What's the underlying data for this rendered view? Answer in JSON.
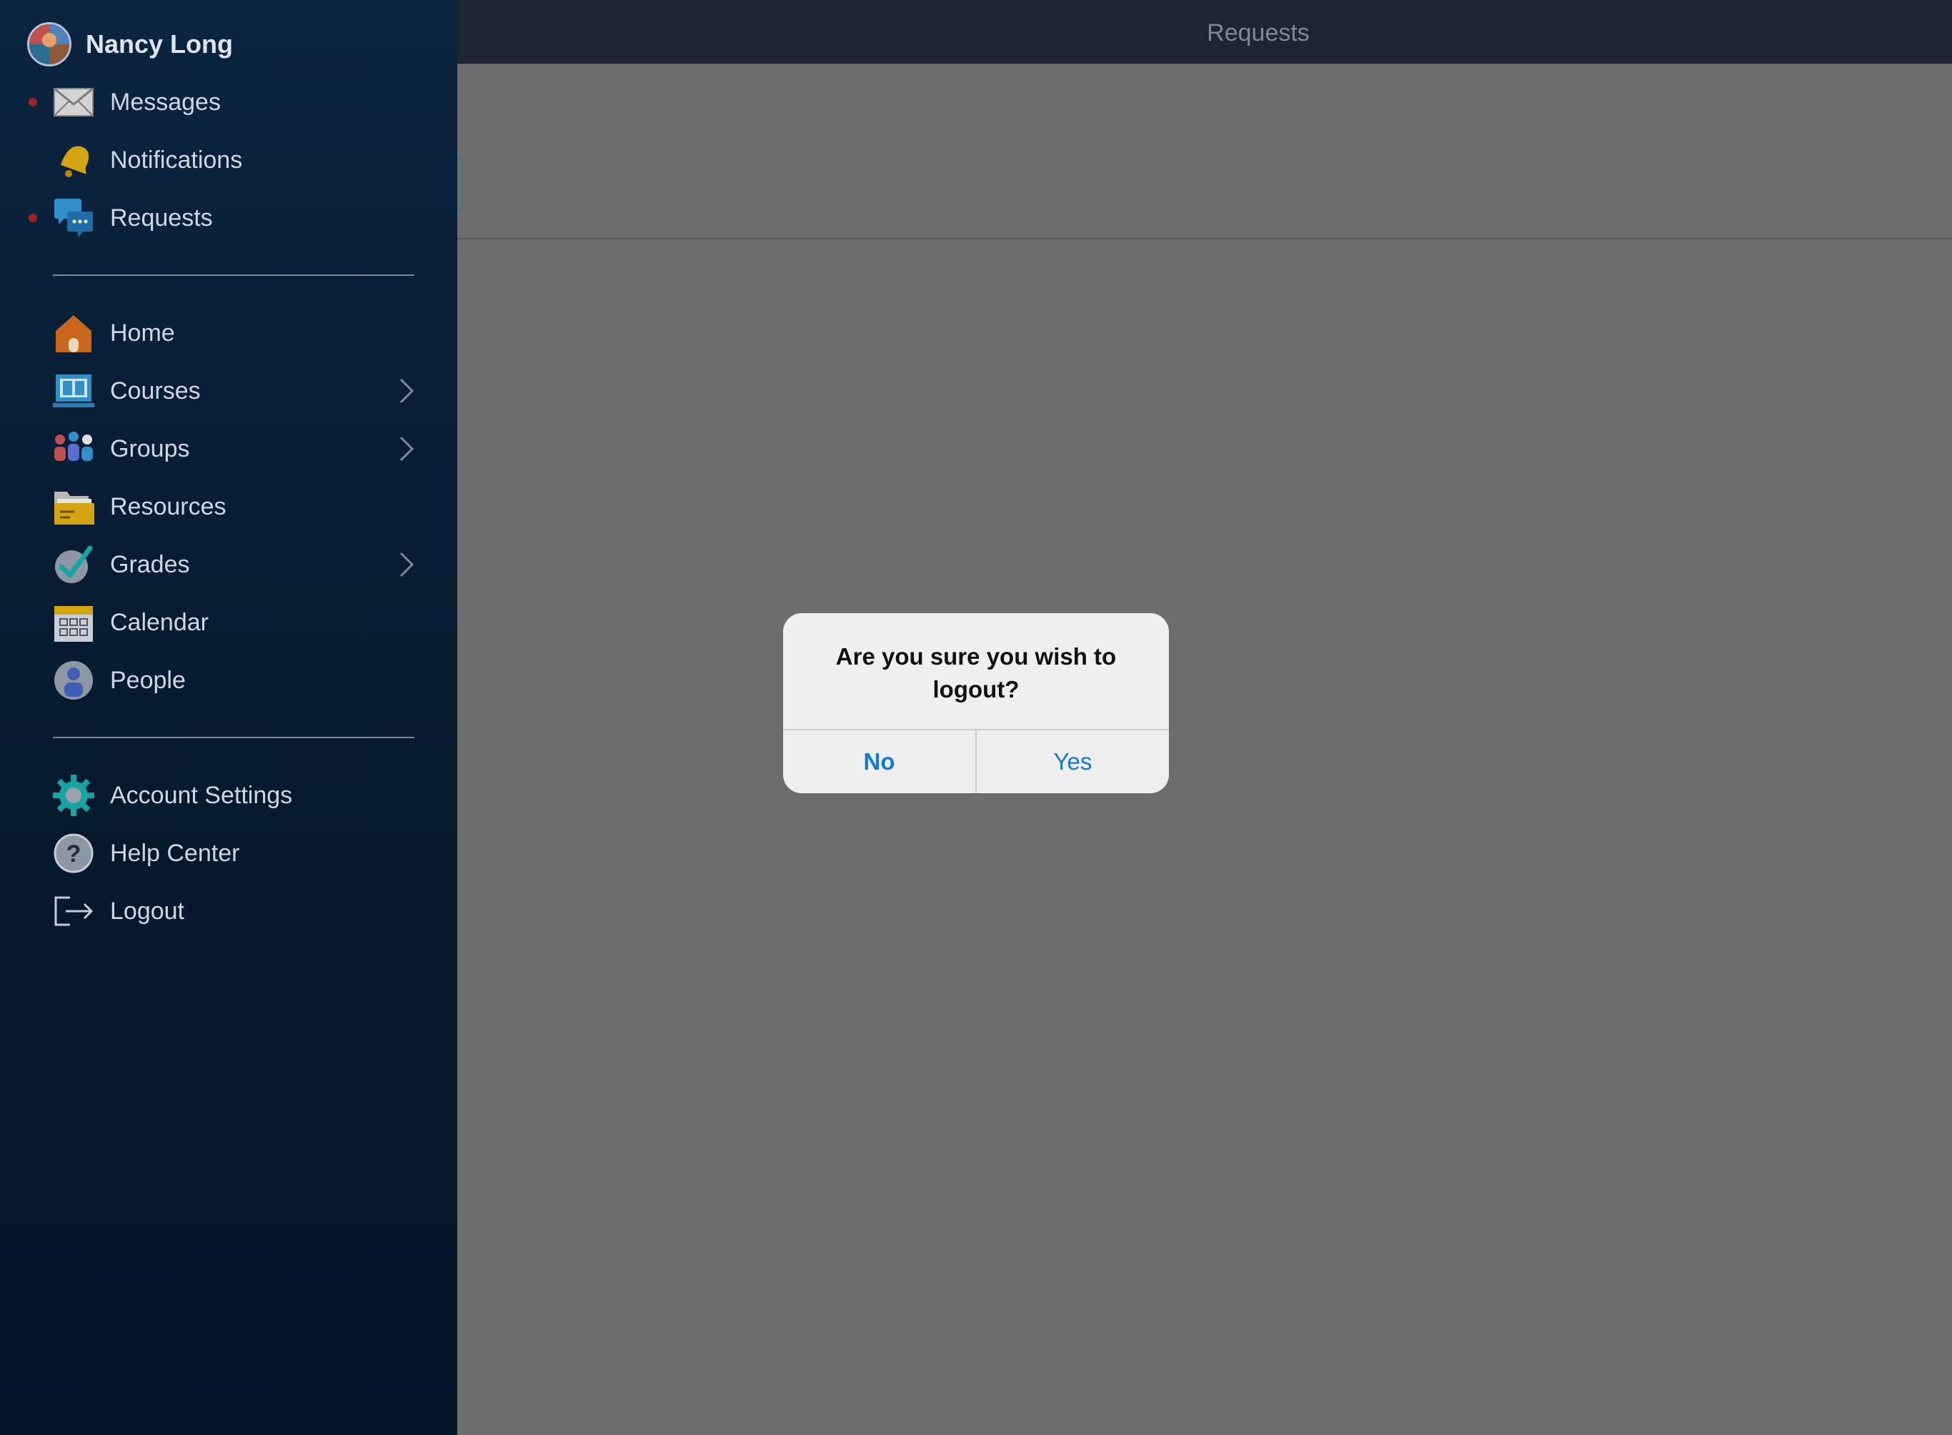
{
  "user": {
    "name": "Nancy Long"
  },
  "header": {
    "title": "Requests"
  },
  "sidebar": {
    "top_items": [
      {
        "label": "Messages",
        "icon": "envelope-icon",
        "badge": true
      },
      {
        "label": "Notifications",
        "icon": "bell-icon",
        "badge": false
      },
      {
        "label": "Requests",
        "icon": "chat-bubbles-icon",
        "badge": true
      }
    ],
    "main_items": [
      {
        "label": "Home",
        "icon": "house-icon",
        "chevron": false
      },
      {
        "label": "Courses",
        "icon": "book-laptop-icon",
        "chevron": true
      },
      {
        "label": "Groups",
        "icon": "people-group-icon",
        "chevron": true
      },
      {
        "label": "Resources",
        "icon": "folder-icon",
        "chevron": false
      },
      {
        "label": "Grades",
        "icon": "checkmark-icon",
        "chevron": true
      },
      {
        "label": "Calendar",
        "icon": "calendar-icon",
        "chevron": false
      },
      {
        "label": "People",
        "icon": "person-icon",
        "chevron": false
      }
    ],
    "bottom_items": [
      {
        "label": "Account Settings",
        "icon": "gear-icon"
      },
      {
        "label": "Help Center",
        "icon": "question-icon"
      },
      {
        "label": "Logout",
        "icon": "logout-icon"
      }
    ]
  },
  "dialog": {
    "message": "Are you sure you wish to logout?",
    "no_label": "No",
    "yes_label": "Yes"
  },
  "colors": {
    "badge": "#a32222",
    "dialog_button": "#1479d6"
  }
}
